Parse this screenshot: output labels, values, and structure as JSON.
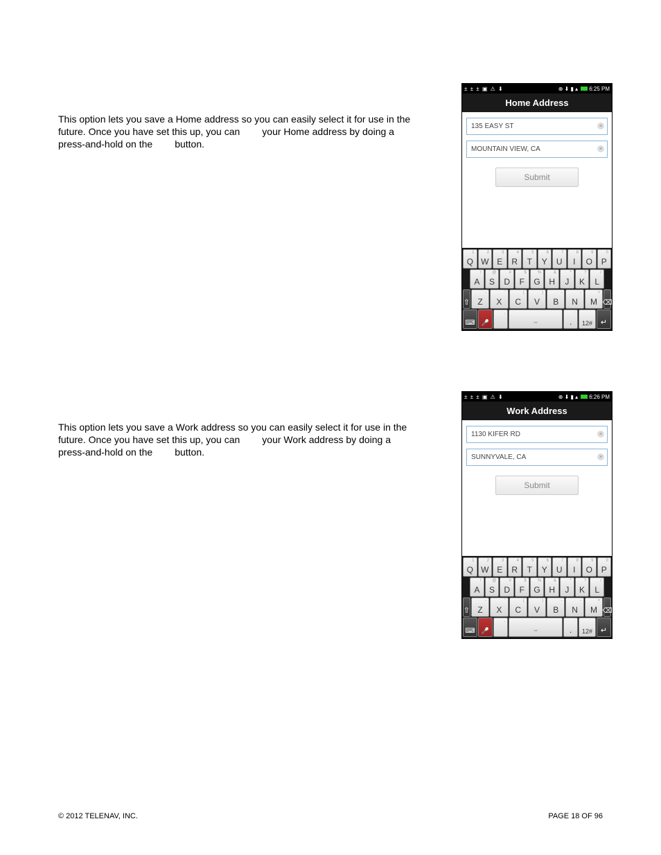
{
  "sections": {
    "home": {
      "line1": "This option lets you save a Home address so you can easily select it for use in the",
      "line2a": "future. Once you have set this up, you can",
      "line2b": "your Home address by doing a",
      "line3a": "press-and-hold on the",
      "line3b": "button.",
      "phone_title": "Home Address",
      "status_time": "6:25 PM",
      "input1": "135 EASY ST",
      "input2": "MOUNTAIN VIEW, CA",
      "submit": "Submit"
    },
    "work": {
      "line1": "This option lets you save a Work address so you can easily select it for use in the",
      "line2a": "future. Once you have set this up, you can",
      "line2b": "your Work address by doing a",
      "line3a": "press-and-hold on the",
      "line3b": "button.",
      "phone_title": "Work Address",
      "status_time": "6:26 PM",
      "input1": "1130 KIFER RD",
      "input2": "SUNNYVALE, CA",
      "submit": "Submit"
    }
  },
  "keyboard": {
    "row1": [
      {
        "main": "Q",
        "sup": "1"
      },
      {
        "main": "W",
        "sup": "2"
      },
      {
        "main": "E",
        "sup": "3"
      },
      {
        "main": "R",
        "sup": "4"
      },
      {
        "main": "T",
        "sup": "5"
      },
      {
        "main": "Y",
        "sup": "6"
      },
      {
        "main": "U",
        "sup": "7"
      },
      {
        "main": "I",
        "sup": "8"
      },
      {
        "main": "O",
        "sup": "9"
      },
      {
        "main": "P",
        "sup": "0"
      }
    ],
    "row2": [
      {
        "main": "A",
        "sup": "!"
      },
      {
        "main": "S",
        "sup": "@"
      },
      {
        "main": "D",
        "sup": "#"
      },
      {
        "main": "F",
        "sup": "$"
      },
      {
        "main": "G",
        "sup": "%"
      },
      {
        "main": "H",
        "sup": "&"
      },
      {
        "main": "J",
        "sup": "*"
      },
      {
        "main": "K",
        "sup": "?"
      },
      {
        "main": "L",
        "sup": "/"
      }
    ],
    "row3": [
      {
        "main": "Z",
        "sup": "-"
      },
      {
        "main": "X",
        "sup": "'"
      },
      {
        "main": "C",
        "sup": "("
      },
      {
        "main": "V",
        "sup": ")"
      },
      {
        "main": "B",
        "sup": "-"
      },
      {
        "main": "N",
        "sup": "-"
      },
      {
        "main": "M",
        "sup": "+"
      }
    ],
    "sym_label": "12#",
    "dot_sup": ":",
    "comma_sup": ","
  },
  "footer": {
    "copyright": "© 2012 TELENAV, INC.",
    "page": "PAGE 18 OF 96"
  }
}
